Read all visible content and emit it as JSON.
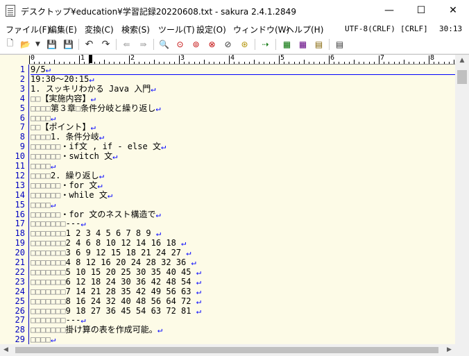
{
  "window": {
    "title": "デスクトップ¥education¥学習記録20220608.txt - sakura 2.4.1.2849",
    "minimize": "—",
    "maximize": "☐",
    "close": "✕"
  },
  "menu": {
    "items": [
      "ファイル(F)",
      "編集(E)",
      "変換(C)",
      "検索(S)",
      "ツール(T)",
      "設定(O)",
      "ウィンドウ(W)",
      "ヘルプ(H)"
    ],
    "encoding": "UTF-8(CRLF)",
    "eol": "[CRLF]",
    "position": "30:13"
  },
  "toolbar": {
    "icons": [
      "new-file-icon",
      "open-folder-icon",
      "dropdown-icon",
      "save-icon",
      "save-all-icon",
      "undo-icon",
      "redo-icon",
      "jump-back-icon",
      "jump-forward-icon",
      "search-icon",
      "search-prev-icon",
      "search-next-icon",
      "replace-icon",
      "search-clear-icon",
      "grep-icon",
      "tag-jump-icon",
      "outline-icon",
      "settings-icon",
      "type-settings-icon",
      "common-settings-icon"
    ]
  },
  "ruler": {
    "labels": [
      "0",
      "1",
      "2",
      "3",
      "4",
      "5",
      "6",
      "7",
      "8"
    ]
  },
  "editor": {
    "line_numbers": [
      "1",
      "2",
      "3",
      "4",
      "5",
      "6",
      "7",
      "8",
      "9",
      "10",
      "11",
      "12",
      "13",
      "14",
      "15",
      "16",
      "17",
      "18",
      "19",
      "20",
      "21",
      "22",
      "23",
      "24",
      "25",
      "26",
      "27",
      "28",
      "29"
    ],
    "lines": [
      "9/5↵",
      "19:30～20:15↵",
      "1. スッキリわかる Java 入門↵",
      "□□【実施内容】↵",
      "□□□□第３章□条件分岐と繰り返し↵",
      "□□□□↵",
      "□□【ポイント】↵",
      "□□□□1. 条件分岐↵",
      "□□□□□□・if文 , if - else 文↵",
      "□□□□□□・switch 文↵",
      "□□□□↵",
      "□□□□2. 繰り返し↵",
      "□□□□□□・for 文↵",
      "□□□□□□・while 文↵",
      "□□□□↵",
      "□□□□□□・for 文のネスト構造で↵",
      "□□□□□□□---↵",
      "□□□□□□□1 2 3 4 5 6 7 8 9 ↵",
      "□□□□□□□2 4 6 8 10 12 14 16 18 ↵",
      "□□□□□□□3 6 9 12 15 18 21 24 27 ↵",
      "□□□□□□□4 8 12 16 20 24 28 32 36 ↵",
      "□□□□□□□5 10 15 20 25 30 35 40 45 ↵",
      "□□□□□□□6 12 18 24 30 36 42 48 54 ↵",
      "□□□□□□□7 14 21 28 35 42 49 56 63 ↵",
      "□□□□□□□8 16 24 32 40 48 56 64 72 ↵",
      "□□□□□□□9 18 27 36 45 54 63 72 81 ↵",
      "□□□□□□□---↵",
      "□□□□□□□掛け算の表を作成可能。↵",
      "□□□□↵"
    ]
  },
  "colors": {
    "editor_bg": "#fdfbe7",
    "line_number": "#0000c0",
    "eol_mark": "#0000ff"
  }
}
